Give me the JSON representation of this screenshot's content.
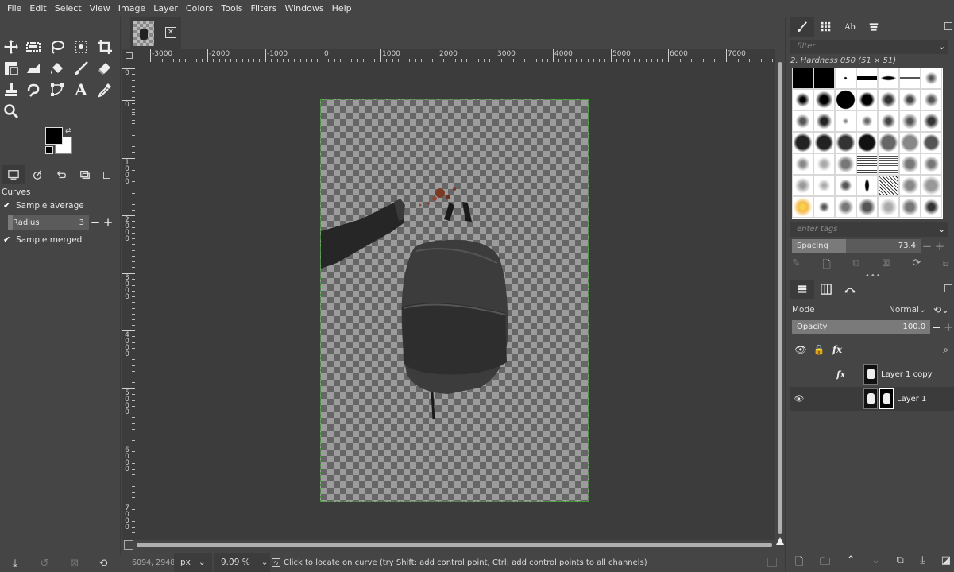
{
  "menu": [
    "File",
    "Edit",
    "Select",
    "View",
    "Image",
    "Layer",
    "Colors",
    "Tools",
    "Filters",
    "Windows",
    "Help"
  ],
  "toolbox": {
    "tools": [
      "move-icon",
      "rect-select-icon",
      "free-select-icon",
      "fuzzy-select-icon",
      "crop-icon",
      "unified-transform-icon",
      "warp-icon",
      "bucket-fill-icon",
      "paintbrush-icon",
      "eraser-icon",
      "clone-icon",
      "smudge-icon",
      "paths-icon",
      "text-icon",
      "color-picker-icon",
      "zoom-icon"
    ],
    "fg_color": "#000000",
    "bg_color": "#ffffff"
  },
  "tool_options": {
    "title": "Curves",
    "sample_average": "Sample average",
    "radius_label": "Radius",
    "radius_value": "3",
    "sample_merged": "Sample merged"
  },
  "ruler": {
    "h_labels": [
      "-3000",
      "-2000",
      "-1000",
      "0",
      "1000",
      "2000",
      "3000",
      "4000",
      "5000",
      "6000",
      "7000"
    ],
    "v_labels": [
      "0",
      "0",
      "1000",
      "2000",
      "3000",
      "4000",
      "5000",
      "6000",
      "7000"
    ]
  },
  "status": {
    "coords": "6094, 2948",
    "unit": "px",
    "zoom": "9.09 %",
    "message": "Click to locate on curve (try Shift: add control point, Ctrl: add control points to all channels)"
  },
  "brushes": {
    "filter_placeholder": "filter",
    "current": "2. Hardness 050 (51 × 51)",
    "tags_placeholder": "enter tags",
    "spacing_label": "Spacing",
    "spacing_value": "73.4"
  },
  "layers": {
    "mode_label": "Mode",
    "mode_value": "Normal",
    "opacity_label": "Opacity",
    "opacity_value": "100.0",
    "items": [
      {
        "name": "Layer 1 copy",
        "visible": false
      },
      {
        "name": "Layer 1",
        "visible": true
      }
    ]
  },
  "colors": {
    "canvas_bg": "#3c3c3c",
    "panel_bg": "#454545",
    "boundary": "#4a9a40"
  }
}
